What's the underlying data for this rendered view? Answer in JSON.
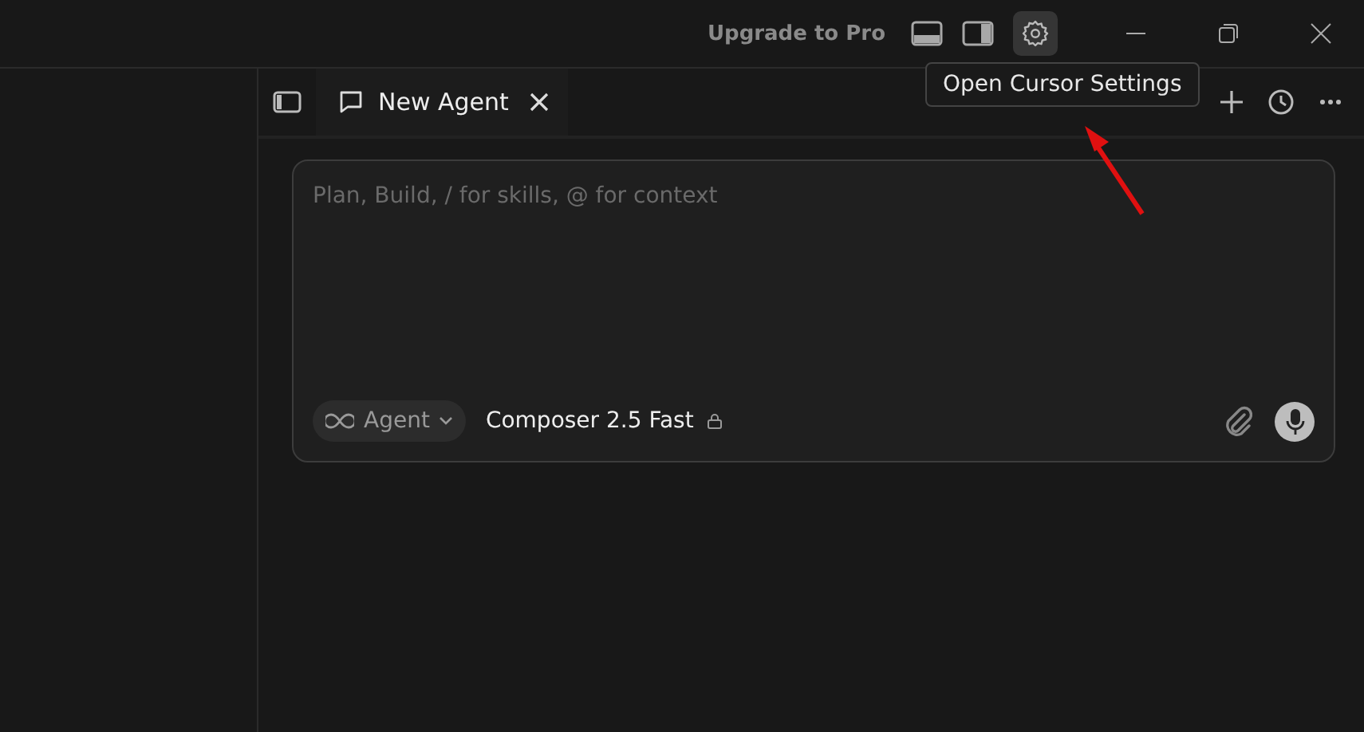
{
  "title_bar": {
    "upgrade_link": "Upgrade to Pro",
    "settings_hovered": true
  },
  "tooltip": {
    "text": "Open Cursor Settings"
  },
  "tabs": [
    {
      "label": "New Agent",
      "selected": true
    }
  ],
  "composer": {
    "placeholder": "Plan, Build, / for skills, @ for context",
    "mode": "Agent",
    "model": "Composer 2.5 Fast"
  }
}
